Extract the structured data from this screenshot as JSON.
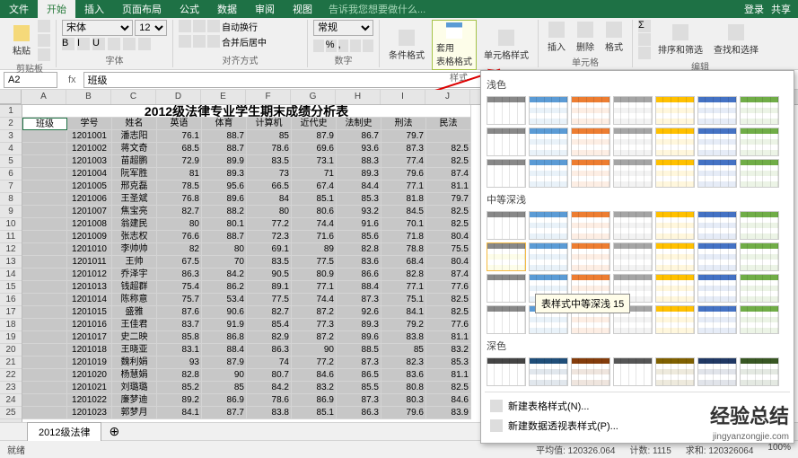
{
  "tabs": [
    "文件",
    "开始",
    "插入",
    "页面布局",
    "公式",
    "数据",
    "审阅",
    "视图"
  ],
  "tellMe": "告诉我您想要做什么...",
  "login": "登录",
  "share": "共享",
  "ribbon": {
    "clipboard": {
      "label": "剪贴板",
      "paste": "粘贴"
    },
    "font": {
      "label": "字体",
      "name": "宋体",
      "size": "12"
    },
    "align": {
      "label": "对齐方式",
      "wrap": "自动换行",
      "merge": "合并后居中"
    },
    "number": {
      "label": "数字",
      "format": "常规"
    },
    "styles": {
      "label": "样式",
      "conditional": "条件格式",
      "table": "套用\n表格格式",
      "cell": "单元格样式"
    },
    "cells": {
      "label": "单元格",
      "insert": "插入",
      "delete": "删除",
      "format": "格式"
    },
    "editing": {
      "label": "编辑",
      "sort": "排序和筛选",
      "find": "查找和选择"
    }
  },
  "namebox": "A2",
  "formula": "班级",
  "annotation": "格式",
  "cols": [
    "A",
    "B",
    "C",
    "D",
    "E",
    "F",
    "G",
    "H",
    "I",
    "J"
  ],
  "title": "2012级法律专业学生期末成绩分析表",
  "headers": [
    "班级",
    "学号",
    "姓名",
    "英语",
    "体育",
    "计算机",
    "近代史",
    "法制史",
    "刑法",
    "民法"
  ],
  "rows": [
    [
      "",
      "1201001",
      "潘志阳",
      "76.1",
      "88.7",
      "85",
      "87.9",
      "86.7",
      "79.7"
    ],
    [
      "",
      "1201002",
      "蒋文奇",
      "68.5",
      "88.7",
      "78.6",
      "69.6",
      "93.6",
      "87.3",
      "82.5"
    ],
    [
      "",
      "1201003",
      "苗超鹏",
      "72.9",
      "89.9",
      "83.5",
      "73.1",
      "88.3",
      "77.4",
      "82.5"
    ],
    [
      "",
      "1201004",
      "阮军胜",
      "81",
      "89.3",
      "73",
      "71",
      "89.3",
      "79.6",
      "87.4"
    ],
    [
      "",
      "1201005",
      "邢克磊",
      "78.5",
      "95.6",
      "66.5",
      "67.4",
      "84.4",
      "77.1",
      "81.1"
    ],
    [
      "",
      "1201006",
      "王圣斌",
      "76.8",
      "89.6",
      "84",
      "85.1",
      "85.3",
      "81.8",
      "79.7"
    ],
    [
      "",
      "1201007",
      "焦宝亮",
      "82.7",
      "88.2",
      "80",
      "80.6",
      "93.2",
      "84.5",
      "82.5"
    ],
    [
      "",
      "1201008",
      "翁建民",
      "80",
      "80.1",
      "77.2",
      "74.4",
      "91.6",
      "70.1",
      "82.5"
    ],
    [
      "",
      "1201009",
      "张志权",
      "76.6",
      "88.7",
      "72.3",
      "71.6",
      "85.6",
      "71.8",
      "80.4"
    ],
    [
      "",
      "1201010",
      "李帅帅",
      "82",
      "80",
      "69.1",
      "89",
      "82.8",
      "78.8",
      "75.5"
    ],
    [
      "",
      "1201011",
      "王帅",
      "67.5",
      "70",
      "83.5",
      "77.5",
      "83.6",
      "68.4",
      "80.4"
    ],
    [
      "",
      "1201012",
      "乔泽宇",
      "86.3",
      "84.2",
      "90.5",
      "80.9",
      "86.6",
      "82.8",
      "87.4"
    ],
    [
      "",
      "1201013",
      "钱超群",
      "75.4",
      "86.2",
      "89.1",
      "77.1",
      "88.4",
      "77.1",
      "77.6"
    ],
    [
      "",
      "1201014",
      "陈称意",
      "75.7",
      "53.4",
      "77.5",
      "74.4",
      "87.3",
      "75.1",
      "82.5"
    ],
    [
      "",
      "1201015",
      "盛雅",
      "87.6",
      "90.6",
      "82.7",
      "87.2",
      "92.6",
      "84.1",
      "82.5"
    ],
    [
      "",
      "1201016",
      "王佳君",
      "83.7",
      "91.9",
      "85.4",
      "77.3",
      "89.3",
      "79.2",
      "77.6"
    ],
    [
      "",
      "1201017",
      "史二映",
      "85.8",
      "86.8",
      "82.9",
      "87.2",
      "89.6",
      "83.8",
      "81.1"
    ],
    [
      "",
      "1201018",
      "王晓亚",
      "83.1",
      "88.4",
      "86.3",
      "90",
      "88.5",
      "85",
      "83.2"
    ],
    [
      "",
      "1201019",
      "魏利娟",
      "93",
      "87.9",
      "74",
      "77.2",
      "87.3",
      "82.3",
      "85.3"
    ],
    [
      "",
      "1201020",
      "杨慧娟",
      "82.8",
      "90",
      "80.7",
      "84.6",
      "86.5",
      "83.6",
      "81.1"
    ],
    [
      "",
      "1201021",
      "刘璐璐",
      "85.2",
      "85",
      "84.2",
      "83.2",
      "85.5",
      "80.8",
      "82.5"
    ],
    [
      "",
      "1201022",
      "廉梦迪",
      "89.2",
      "86.9",
      "78.6",
      "86.9",
      "87.3",
      "80.3",
      "84.6"
    ],
    [
      "",
      "1201023",
      "郭梦月",
      "84.1",
      "87.7",
      "83.8",
      "85.1",
      "86.3",
      "79.6",
      "83.9"
    ]
  ],
  "dropdown": {
    "light": "浅色",
    "medium": "中等深浅",
    "dark": "深色",
    "tooltip": "表样式中等深浅 15",
    "newTable": "新建表格样式(N)...",
    "newPivot": "新建数据透视表样式(P)..."
  },
  "lightColors": [
    "#888",
    "#5b9bd5",
    "#ed7d31",
    "#a5a5a5",
    "#ffc000",
    "#4472c4",
    "#70ad47"
  ],
  "mediumColors": [
    "#888",
    "#5b9bd5",
    "#ed7d31",
    "#a5a5a5",
    "#ffc000",
    "#4472c4",
    "#70ad47"
  ],
  "darkColors": [
    "#444",
    "#1f4e79",
    "#843c0b",
    "#555",
    "#7f6000",
    "#203864",
    "#385723"
  ],
  "sheetTab": "2012级法律",
  "status": {
    "ready": "就绪",
    "avg": "平均值: 120326.064",
    "count": "计数: 1115",
    "sum": "求和: 120326064",
    "zoom": "100%"
  },
  "watermark": "经验总结",
  "watermarkUrl": "jingyanzongjie.com"
}
